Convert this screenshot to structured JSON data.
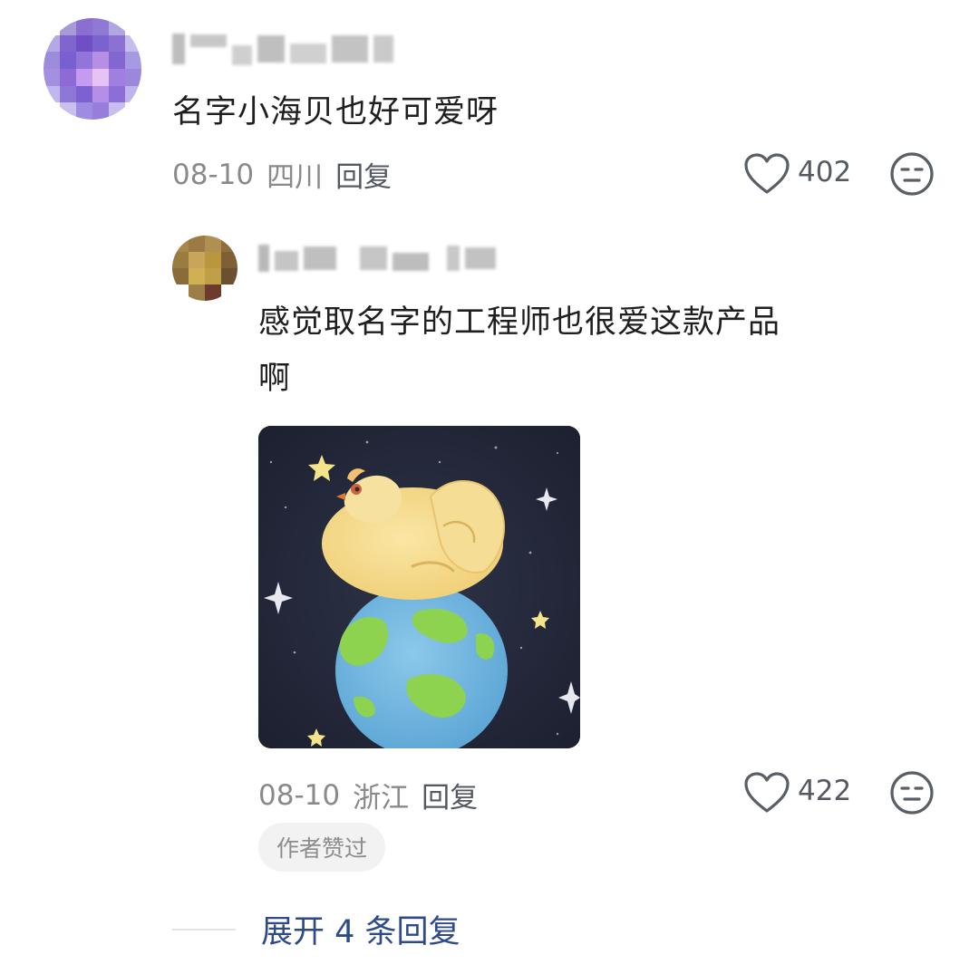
{
  "comments": [
    {
      "text": "名字小海贝也好可爱呀",
      "date": "08-10",
      "location": "四川",
      "reply_label": "回复",
      "likes": "402"
    },
    {
      "text_line1": "感觉取名字的工程师也很爱这款产品",
      "text_line2": "啊",
      "date": "08-10",
      "location": "浙江",
      "reply_label": "回复",
      "likes": "422",
      "badge": "作者赞过"
    }
  ],
  "expand_label": "展开 4 条回复",
  "colors": {
    "text": "#1f1f1f",
    "meta": "#8a8a8a",
    "link": "#2d4a8a",
    "image_bg": "#24283a"
  },
  "icons": [
    "heart-outline-icon",
    "neutral-face-icon"
  ]
}
